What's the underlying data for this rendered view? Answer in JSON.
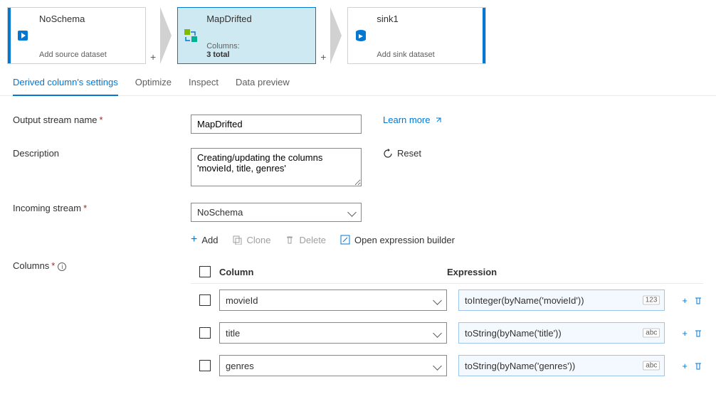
{
  "flow": {
    "nodes": [
      {
        "title": "NoSchema",
        "subtitle": "Add source dataset",
        "icon": "database-arrow-icon",
        "selected": false,
        "hasRightAccent": false,
        "leftAccent": true
      },
      {
        "title": "MapDrifted",
        "subtitle": "Columns:",
        "subtitle2": "3 total",
        "icon": "transform-icon",
        "selected": true,
        "hasRightAccent": false,
        "leftAccent": false
      },
      {
        "title": "sink1",
        "subtitle": "Add sink dataset",
        "icon": "database-sink-icon",
        "selected": false,
        "hasRightAccent": true,
        "leftAccent": false
      }
    ],
    "plus": "+"
  },
  "tabs": {
    "items": [
      "Derived column's settings",
      "Optimize",
      "Inspect",
      "Data preview"
    ],
    "activeIndex": 0
  },
  "settings": {
    "outputStreamName": {
      "label": "Output stream name",
      "value": "MapDrifted",
      "required": true
    },
    "description": {
      "label": "Description",
      "value": "Creating/updating the columns 'movieId, title, genres'"
    },
    "incomingStream": {
      "label": "Incoming stream",
      "value": "NoSchema",
      "required": true
    },
    "learnMore": "Learn more",
    "reset": "Reset",
    "columnsLabel": "Columns"
  },
  "toolbar": {
    "add": "Add",
    "clone": "Clone",
    "delete": "Delete",
    "openBuilder": "Open expression builder"
  },
  "table": {
    "headers": {
      "column": "Column",
      "expression": "Expression"
    },
    "rows": [
      {
        "name": "movieId",
        "expr": "toInteger(byName('movieId'))",
        "badge": "123"
      },
      {
        "name": "title",
        "expr": "toString(byName('title'))",
        "badge": "abc"
      },
      {
        "name": "genres",
        "expr": "toString(byName('genres'))",
        "badge": "abc"
      }
    ]
  }
}
